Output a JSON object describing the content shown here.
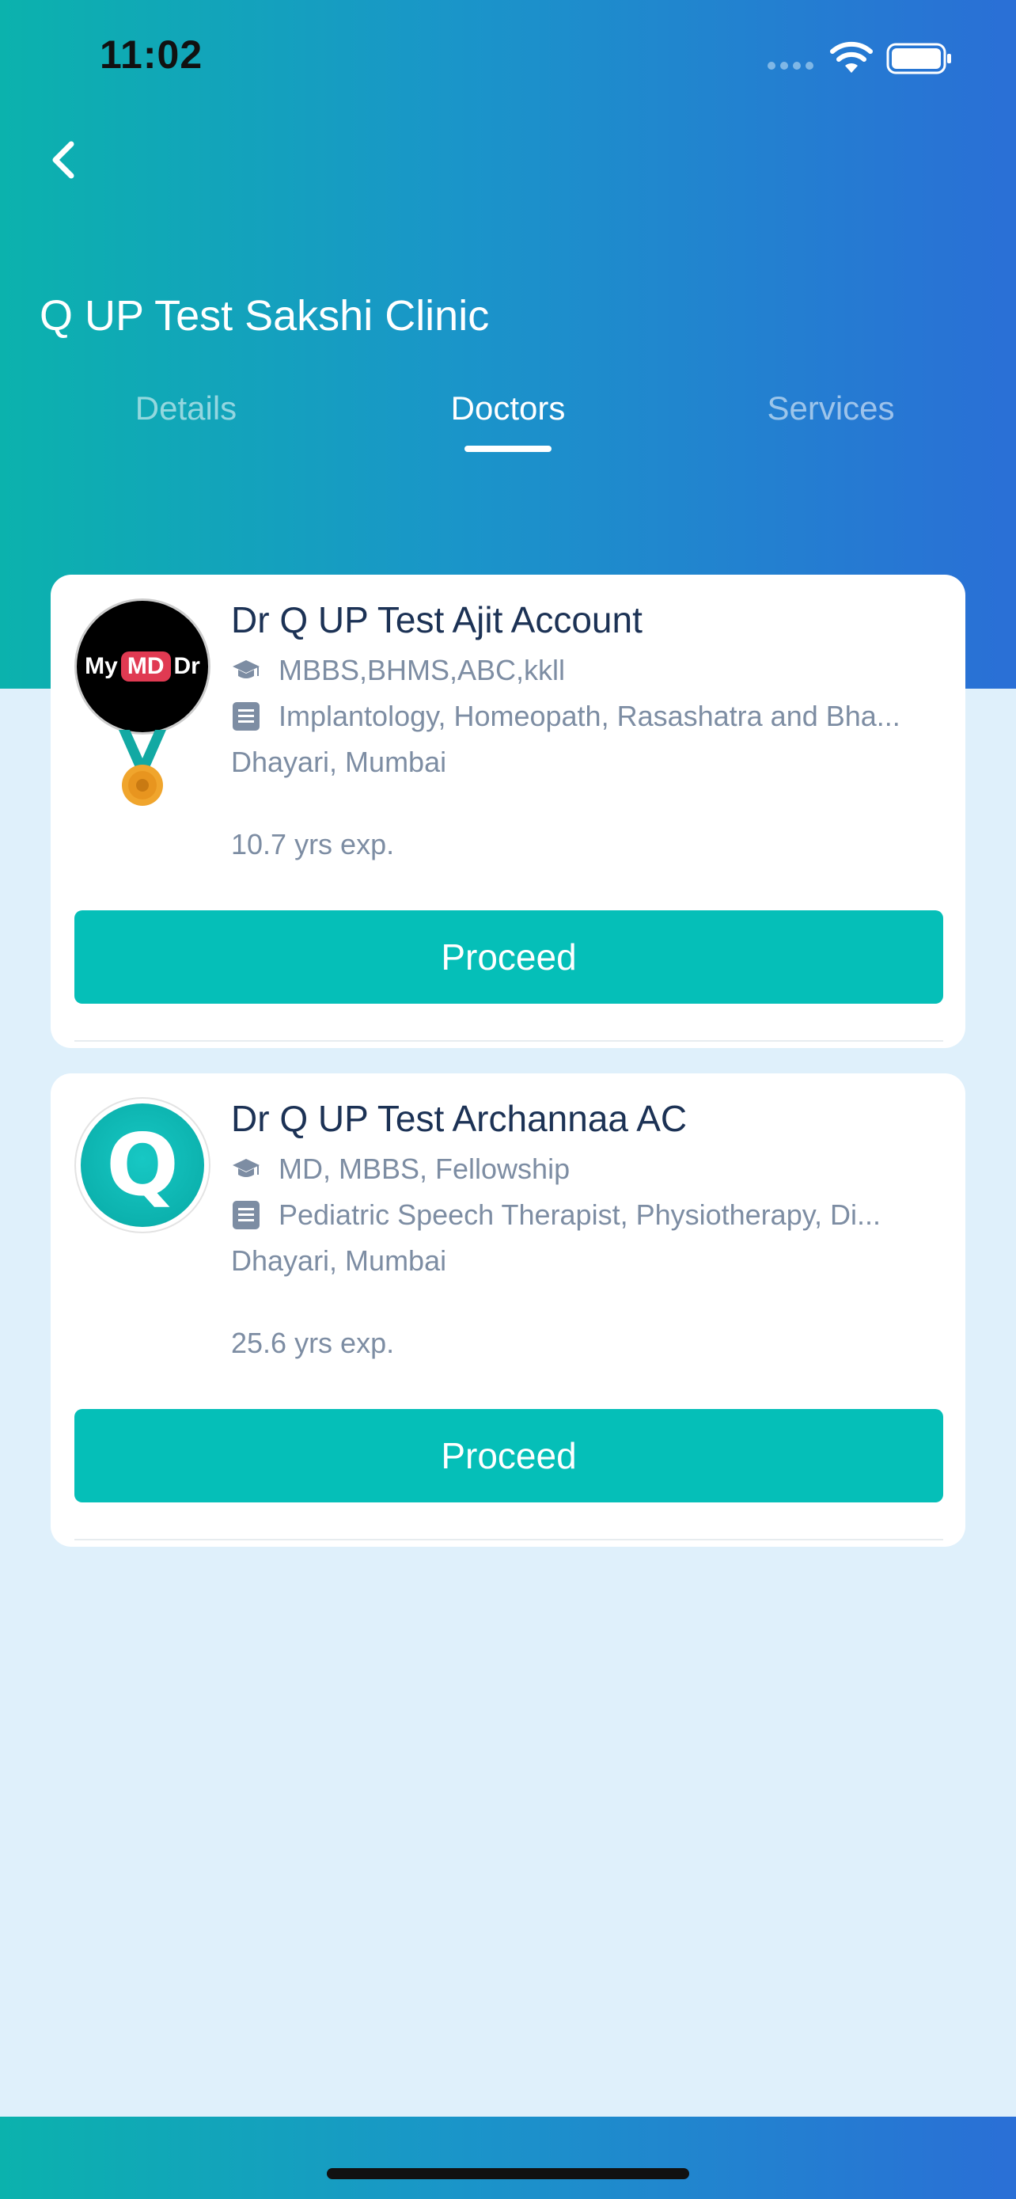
{
  "status_bar": {
    "time": "11:02"
  },
  "header": {
    "title": "Q UP Test Sakshi Clinic",
    "tabs": [
      {
        "label": "Details",
        "active": false
      },
      {
        "label": "Doctors",
        "active": true
      },
      {
        "label": "Services",
        "active": false
      }
    ]
  },
  "doctors": [
    {
      "name": "Dr Q UP Test Ajit Account",
      "degrees": "MBBS,BHMS,ABC,kkll",
      "specialities": "Implantology, Homeopath, Rasashatra and Bha...",
      "location": "Dhayari, Mumbai",
      "experience": "10.7 yrs exp.",
      "button_label": "Proceed",
      "logo": {
        "left": "My",
        "middle": "MD",
        "right": "Dr"
      }
    },
    {
      "name": "Dr Q UP Test Archannaa AC",
      "degrees": "MD, MBBS, Fellowship",
      "specialities": "Pediatric Speech Therapist, Physiotherapy, Di...",
      "location": "Dhayari, Mumbai",
      "experience": "25.6 yrs exp.",
      "button_label": "Proceed",
      "avatar_letter": "Q"
    }
  ],
  "colors": {
    "accent": "#05bfb8",
    "header_gradient_start": "#0bb2ad",
    "header_gradient_end": "#2a6fd6",
    "background": "#dff0fb"
  }
}
